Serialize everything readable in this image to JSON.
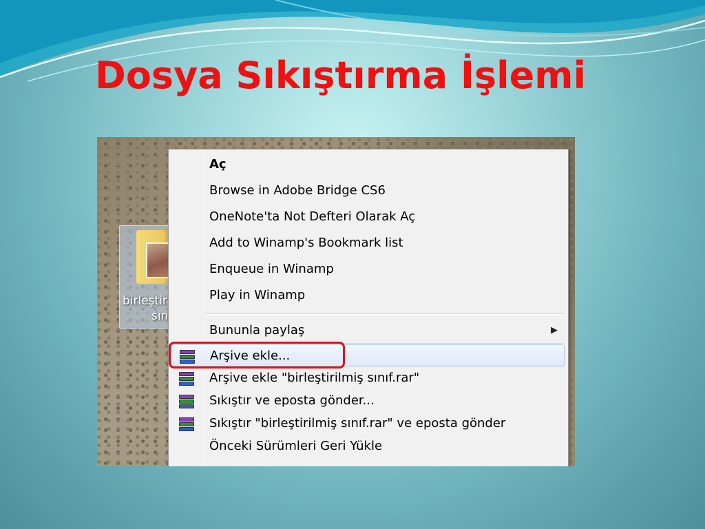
{
  "slide": {
    "title": "Dosya Sıkıştırma İşlemi"
  },
  "desktop_icon": {
    "label_line1": "birleştir",
    "label_line2": "sını"
  },
  "context_menu": {
    "items": [
      {
        "label": "Aç",
        "bold": true
      },
      {
        "label": "Browse in Adobe Bridge CS6"
      },
      {
        "label": "OneNote'ta Not Defteri Olarak Aç"
      },
      {
        "label": "Add to Winamp's Bookmark list"
      },
      {
        "label": "Enqueue in Winamp"
      },
      {
        "label": "Play in Winamp"
      },
      {
        "label": "Bununla paylaş",
        "submenu": true
      },
      {
        "label": "Arşive ekle...",
        "icon": "winrar-icon",
        "highlighted": true
      },
      {
        "label": "Arşive ekle \"birleştirilmiş sınıf.rar\"",
        "icon": "winrar-icon"
      },
      {
        "label": "Sıkıştır ve eposta gönder...",
        "icon": "winrar-icon"
      },
      {
        "label": "Sıkıştır \"birleştirilmiş sınıf.rar\" ve eposta gönder",
        "icon": "winrar-icon"
      },
      {
        "label": "Önceki Sürümleri Geri Yükle"
      }
    ],
    "submenu_arrow": "▶"
  },
  "colors": {
    "title": "#ee1111",
    "callout": "#e01010",
    "highlight": "#dfe9f9"
  }
}
